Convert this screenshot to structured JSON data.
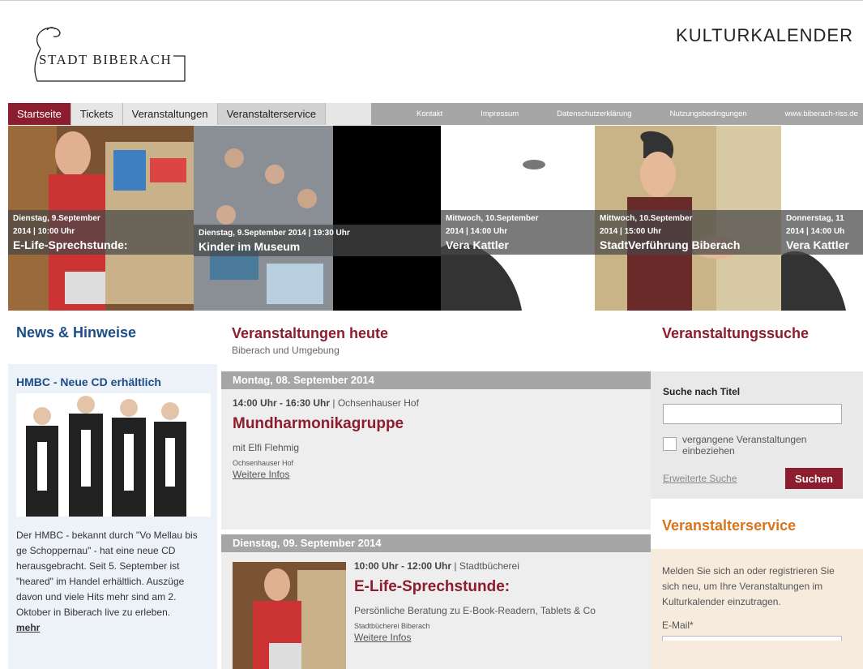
{
  "header": {
    "logo_text": "STADT BIBERACH",
    "site_title": "KULTURKALENDER"
  },
  "nav": {
    "main": [
      "Startseite",
      "Tickets",
      "Veranstaltungen",
      "Veranstalterservice"
    ],
    "meta": [
      "Kontakt",
      "Impressum",
      "Datenschutzerklärung",
      "Nutzungsbedingungen",
      "www.biberach-riss.de"
    ]
  },
  "slider": [
    {
      "date": "Dienstag, 9.September",
      "date2": "2014 | 10:00 Uhr",
      "title": "E-Life-Sprechstunde:"
    },
    {
      "date": "Dienstag, 9.September 2014 | 19:30 Uhr",
      "title": "Kinder im Museum"
    },
    {
      "date": "Mittwoch, 10.September",
      "date2": "2014 | 14:00 Uhr",
      "title": "Vera Kattler"
    },
    {
      "date": "Mittwoch, 10.September",
      "date2": "2014 | 15:00 Uhr",
      "title": "StadtVerführung Biberach"
    },
    {
      "date": "Donnerstag, 11",
      "date2": "2014 | 14:00 Uh",
      "title": "Vera Kattler"
    }
  ],
  "news": {
    "heading": "News & Hinweise",
    "item_title": "HMBC - Neue CD erhältlich",
    "item_text": "Der HMBC - bekannt durch \"Vo Mellau bis ge Schoppernau\" - hat eine neue CD herausgebracht. Seit 5. September ist \"heared\" im Handel erhältlich. Auszüge davon und viele Hits mehr sind am 2. Oktober in Biberach live zu erleben.",
    "more_label": "mehr"
  },
  "events": {
    "heading": "Veranstaltungen heute",
    "subheading": "Biberach und Umgebung",
    "days": [
      {
        "label": "Montag, 08. September 2014",
        "time": "14:00 Uhr - 16:30 Uhr",
        "place": "Ochsenhauser Hof",
        "title": "Mundharmonikagruppe",
        "desc": "mit Elfi Flehmig",
        "location": "Ochsenhauser Hof",
        "link": "Weitere Infos"
      },
      {
        "label": "Dienstag, 09. September 2014",
        "time": "10:00 Uhr - 12:00 Uhr",
        "place": "Stadtbücherei",
        "title": "E-Life-Sprechstunde:",
        "desc": "Persönliche Beratung zu E-Book-Readern, Tablets & Co",
        "location": "Stadtbücherei Biberach",
        "link": "Weitere Infos"
      }
    ]
  },
  "search": {
    "heading": "Veranstaltungssuche",
    "title_label": "Suche nach Titel",
    "title_value": "",
    "past_label": "vergangene Veranstaltungen einbeziehen",
    "advanced_label": "Erweiterte Suche",
    "button_label": "Suchen"
  },
  "organizer": {
    "heading": "Veranstalterservice",
    "text": "Melden Sie sich an oder registrieren Sie sich neu, um Ihre Veranstaltungen im Kulturkalender einzutragen.",
    "email_label": "E-Mail*"
  },
  "colors": {
    "brand_red": "#8c1d2e",
    "news_blue": "#1c4d86",
    "organizer_orange": "#d9741a",
    "bar_grey": "#a6a6a6"
  }
}
